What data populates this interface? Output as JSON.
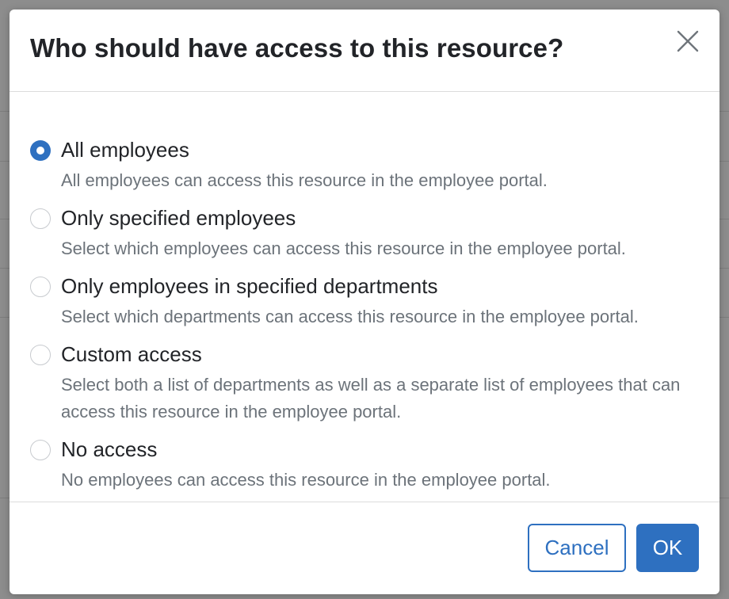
{
  "dialog": {
    "title": "Who should have access to this resource?",
    "close_icon": "close-icon",
    "options": [
      {
        "label": "All employees",
        "description": "All employees can access this resource in the employee portal.",
        "checked": true
      },
      {
        "label": "Only specified employees",
        "description": "Select which employees can access this resource in the employee portal.",
        "checked": false
      },
      {
        "label": "Only employees in specified departments",
        "description": "Select which departments can access this resource in the employee portal.",
        "checked": false
      },
      {
        "label": "Custom access",
        "description": "Select both a list of departments as well as a separate list of employees that can access this resource in the employee portal.",
        "checked": false
      },
      {
        "label": "No access",
        "description": "No employees can access this resource in the employee portal.",
        "checked": false
      }
    ],
    "buttons": {
      "cancel": "Cancel",
      "ok": "OK"
    }
  },
  "colors": {
    "accent": "#2e70c0",
    "title_text": "#222428",
    "description_text": "#6c737a",
    "overlay": "#8d8d8d"
  }
}
